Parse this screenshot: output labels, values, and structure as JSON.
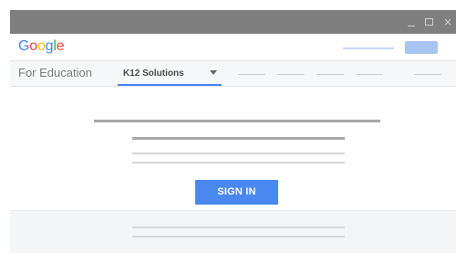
{
  "window": {
    "minimize_icon": "minimize-icon",
    "maximize_icon": "maximize-icon",
    "close_glyph": "×"
  },
  "brand": {
    "logo_letters": [
      "G",
      "o",
      "o",
      "g",
      "l",
      "e"
    ],
    "logo_colors": [
      "#4285f4",
      "#ea4335",
      "#fbbc05",
      "#4285f4",
      "#34a853",
      "#ea4335"
    ]
  },
  "subnav": {
    "section_label": "For Education",
    "active_tab_label": "K12 Solutions",
    "accent_color": "#4285f4"
  },
  "main": {
    "signin_label": "SIGN IN",
    "button_color": "#4a87ef"
  }
}
